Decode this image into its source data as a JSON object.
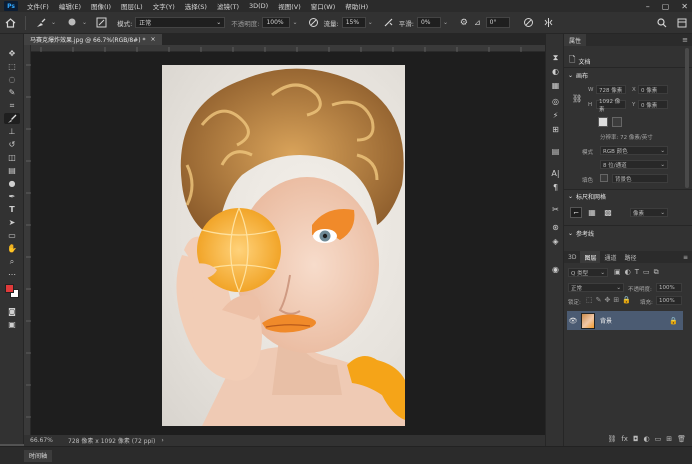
{
  "menubar": {
    "logo": "Ps",
    "items": [
      "文件(F)",
      "编辑(E)",
      "图像(I)",
      "图层(L)",
      "文字(Y)",
      "选择(S)",
      "滤镜(T)",
      "3D(D)",
      "视图(V)",
      "窗口(W)",
      "帮助(H)"
    ]
  },
  "options": {
    "mode_label": "模式:",
    "mode_value": "正常",
    "opacity_label": "不透明度:",
    "opacity_value": "100%",
    "flow_label": "流量:",
    "flow_value": "15%",
    "smooth_label": "平滑:",
    "smooth_value": "0%",
    "angle_value": "0°"
  },
  "document": {
    "tab_title": "马赛克爆炸效果.jpg @ 66.7%(RGB/8#) *",
    "close": "×"
  },
  "status": {
    "zoom": "66.67%",
    "doc_info": "728 像素 x 1092 像素 (72 ppi)"
  },
  "timeline": {
    "label": "时间轴"
  },
  "properties": {
    "tab": "属性",
    "doc_label": "文档",
    "canvas_header": "画布",
    "w_label": "W",
    "w_value": "728 像素",
    "h_label": "H",
    "h_value": "1092 像素",
    "x_label": "X",
    "x_value": "0 像素",
    "y_label": "Y",
    "y_value": "0 像素",
    "resolution": "分辨率: 72 像素/英寸",
    "mode_label": "模式",
    "mode_value": "RGB 颜色",
    "depth_value": "8 位/通道",
    "fill_label": "填色",
    "fill_value": "背景色",
    "rulers_header": "标尺和网格",
    "units_value": "像素",
    "guides_header": "参考线"
  },
  "layers_panel": {
    "tabs": [
      "3D",
      "图层",
      "通道",
      "路径"
    ],
    "active_tab": "图层",
    "filter_label": "Q 类型",
    "blend_value": "正常",
    "opacity_label": "不透明度:",
    "opacity_value": "100%",
    "lock_label": "锁定:",
    "fill_label": "填充:",
    "fill_value": "100%",
    "layer_name": "背景"
  },
  "colors": {
    "foreground": "#e03a3a",
    "background": "#ffffff",
    "accent": "#31a8ff"
  }
}
